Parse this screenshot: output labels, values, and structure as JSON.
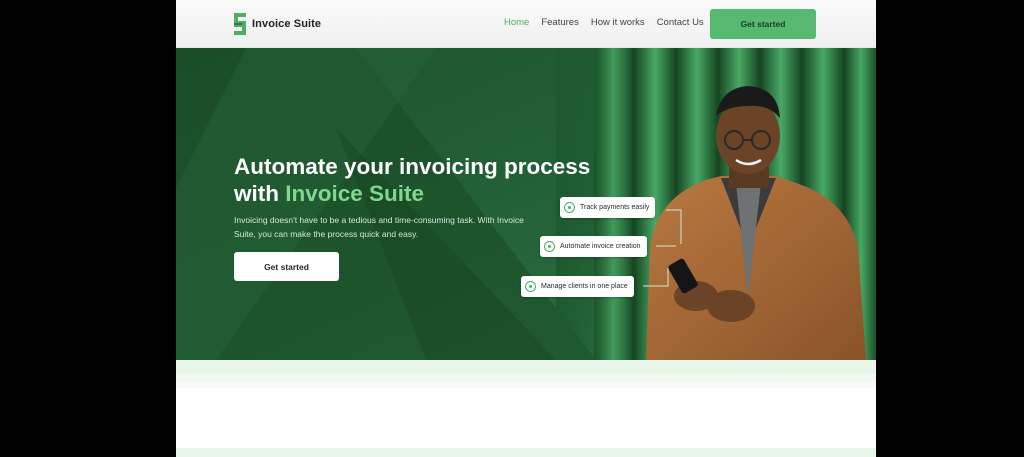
{
  "brand": {
    "name": "Invoice Suite",
    "accent_color": "#57b86f"
  },
  "nav": {
    "links": [
      {
        "label": "Home",
        "active": true
      },
      {
        "label": "Features",
        "active": false
      },
      {
        "label": "How it works",
        "active": false
      },
      {
        "label": "Contact Us",
        "active": false
      }
    ],
    "cta_label": "Get started"
  },
  "hero": {
    "title_main": "Automate your invoicing process with ",
    "title_accent": "Invoice Suite",
    "description": "Invoicing doesn't have to be a tedious and time-consuming task. With Invoice Suite, you can make the process quick and easy.",
    "button_label": "Get started",
    "background_color": "#1f5a2e",
    "feature_tags": [
      {
        "label": "Track payments easily"
      },
      {
        "label": "Automate invoice creation"
      },
      {
        "label": "Manage clients in one place"
      }
    ]
  }
}
